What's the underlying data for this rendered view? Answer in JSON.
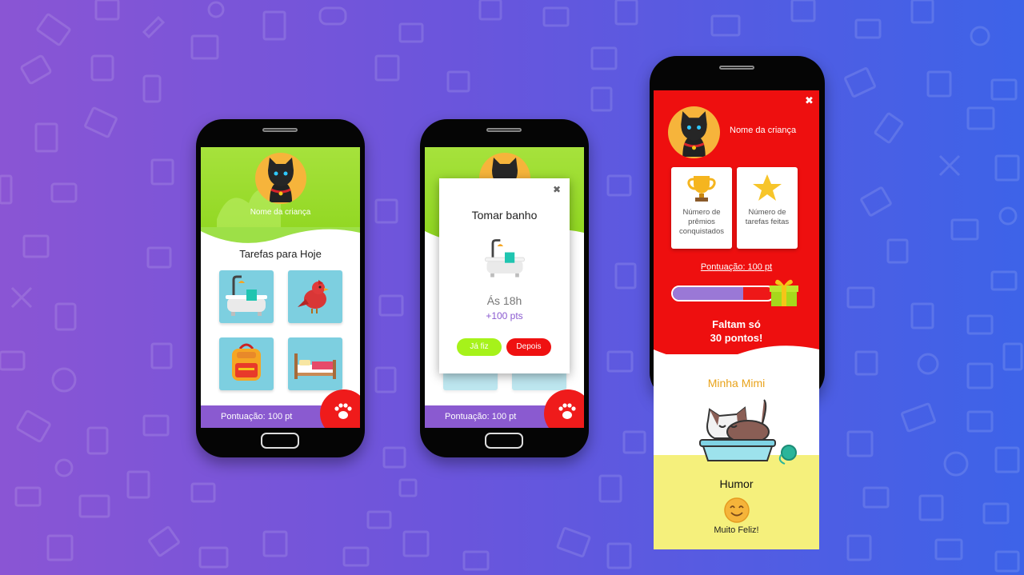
{
  "colors": {
    "background_left": "#8a55d4",
    "background_right": "#3d63e8",
    "header_green": "#a6e23c",
    "footer_purple": "#8a5ad0",
    "accent_red": "#ef1b1b",
    "profile_red": "#ee0f0f",
    "lime_button": "#a6f21a",
    "tile_blue": "#7dcfe0",
    "mood_yellow": "#f5f07c",
    "mimi_orange": "#e9a31b"
  },
  "screen1": {
    "child_name": "Nome da criança",
    "section_title": "Tarefas para Hoje",
    "tasks": [
      {
        "icon": "bathtub-icon"
      },
      {
        "icon": "bird-icon"
      },
      {
        "icon": "backpack-icon"
      },
      {
        "icon": "bed-icon"
      }
    ],
    "score_label": "Pontuação: 100 pt",
    "paw_icon": "paw-icon"
  },
  "screen2": {
    "modal": {
      "title": "Tomar banho",
      "close": "✖",
      "icon": "bathtub-icon",
      "time": "Ás 18h",
      "points": "+100 pts",
      "done_button": "Já fiz",
      "later_button": "Depois"
    },
    "score_label": "Pontuação: 100 pt"
  },
  "screen3": {
    "close": "✖",
    "child_name": "Nome da criança",
    "cards": [
      {
        "icon": "trophy-icon",
        "label": "Número de prêmios conquistados"
      },
      {
        "icon": "star-icon",
        "label": "Número de tarefas feitas"
      }
    ],
    "score_link": "Pontuação: 100 pt",
    "progress": {
      "value": 0.7,
      "reward_icon": "gift-icon"
    },
    "remaining_line1": "Faltam só",
    "remaining_line2": "30 pontos!",
    "pet_title": "Minha Mimi",
    "mood_label": "Humor",
    "mood_value": "Muito Feliz!"
  }
}
